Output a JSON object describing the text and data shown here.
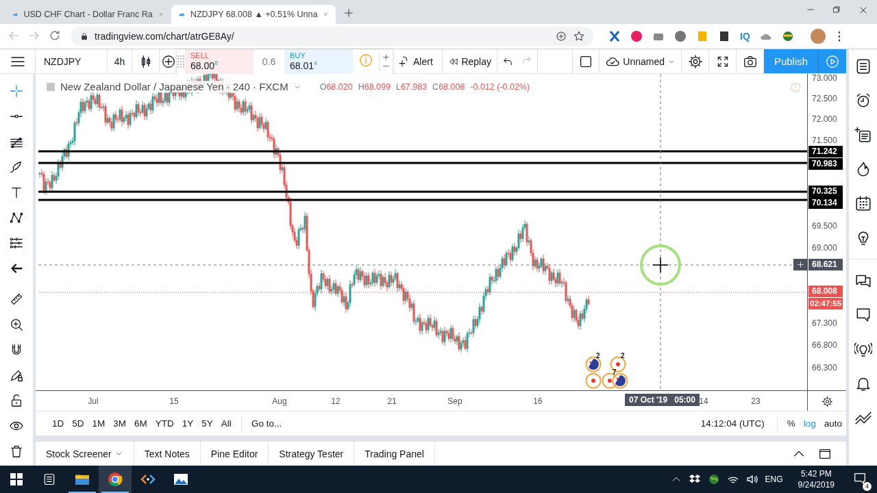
{
  "browser": {
    "tabs": [
      {
        "title": "USD CHF Chart - Dollar Franc Ra",
        "selected": false
      },
      {
        "title": "NZDJPY 68.008 ▲ +0.51% Unna",
        "selected": true
      }
    ],
    "address": "tradingview.com/chart/atrGE8Ay/",
    "extension_label": "IQ"
  },
  "toolbar": {
    "symbol": "NZDJPY",
    "interval": "4h",
    "sell": {
      "label": "SELL",
      "price": "68.00$^{8}$"
    },
    "spread": "0.6",
    "buy": {
      "label": "BUY",
      "price": "68.01$^{4}$"
    },
    "alert": "Alert",
    "replay": "Replay",
    "layout": "Unnamed",
    "publish": "Publish"
  },
  "left_tools": [
    {
      "kind": "crosshair",
      "selected": true
    },
    {
      "kind": "hline",
      "selected": false
    },
    {
      "kind": "fib",
      "selected": false
    },
    {
      "kind": "brush",
      "selected": false
    },
    {
      "kind": "text",
      "selected": false
    },
    {
      "kind": "pattern",
      "selected": false
    },
    {
      "kind": "projection",
      "selected": false
    },
    {
      "kind": "hide",
      "selected": false
    },
    {
      "kind": "ruler",
      "selected": false
    },
    {
      "kind": "zoom",
      "selected": false
    },
    {
      "kind": "magnet",
      "selected": false
    },
    {
      "kind": "lockdraw",
      "selected": false
    },
    {
      "kind": "lock",
      "selected": false
    },
    {
      "kind": "eye",
      "selected": false
    },
    {
      "kind": "trash",
      "selected": false
    }
  ],
  "chart": {
    "legend": {
      "title": "New Zealand Dollar / Japanese Yen · 240 · FXCM",
      "ohlc": [
        {
          "key": "O",
          "value": "68.020"
        },
        {
          "key": "H",
          "value": "68.099"
        },
        {
          "key": "L",
          "value": "67.983"
        },
        {
          "key": "C",
          "value": "68.008"
        }
      ],
      "change": "-0.012 (-0.02%)"
    },
    "price_ticks": [
      "73.000",
      "72.500",
      "72.000",
      "71.500",
      "69.500",
      "69.000",
      "67.300",
      "66.800",
      "66.300"
    ],
    "levels": [
      {
        "label": "71.242"
      },
      {
        "label": "70.983"
      },
      {
        "label": "70.325"
      },
      {
        "label": "70.134"
      }
    ],
    "last_price": {
      "label": "68.008",
      "countdown": "02:47:55"
    },
    "crosshair": {
      "price": "68.621",
      "date": "07 Oct '19",
      "time": "05:00"
    },
    "time_ticks": [
      "Jul",
      "15",
      "Aug",
      "12",
      "21",
      "Sep",
      "16",
      "14",
      "23"
    ],
    "events": [
      {
        "kind": "flag",
        "count": "2"
      },
      {
        "kind": "dot",
        "count": "2"
      },
      {
        "kind": "dot"
      },
      {
        "kind": "dot",
        "count": "7"
      },
      {
        "kind": "flag"
      }
    ]
  },
  "range_bar": {
    "ranges": [
      "1D",
      "5D",
      "1M",
      "3M",
      "6M",
      "YTD",
      "1Y",
      "5Y",
      "All"
    ],
    "goto": "Go to...",
    "clock": "14:12:04 (UTC)",
    "scale_options": [
      {
        "label": "%",
        "selected": false
      },
      {
        "label": "log",
        "selected": true
      },
      {
        "label": "auto",
        "selected": false
      }
    ]
  },
  "bottom_tabs": [
    {
      "label": "Stock Screener",
      "dropdown": true
    },
    {
      "label": "Text Notes",
      "dropdown": false
    },
    {
      "label": "Pine Editor",
      "dropdown": false
    },
    {
      "label": "Strategy Tester",
      "dropdown": false
    },
    {
      "label": "Trading Panel",
      "dropdown": false
    }
  ],
  "taskbar": {
    "apps": [
      {
        "kind": "folder",
        "running": true,
        "selected": false
      },
      {
        "kind": "chrome",
        "running": true,
        "selected": true
      },
      {
        "kind": "code",
        "running": false,
        "selected": false
      },
      {
        "kind": "photos",
        "running": false,
        "selected": false
      }
    ],
    "language": "ENG",
    "time": "5:42 PM",
    "date": "9/24/2019",
    "notifications": "4"
  }
}
